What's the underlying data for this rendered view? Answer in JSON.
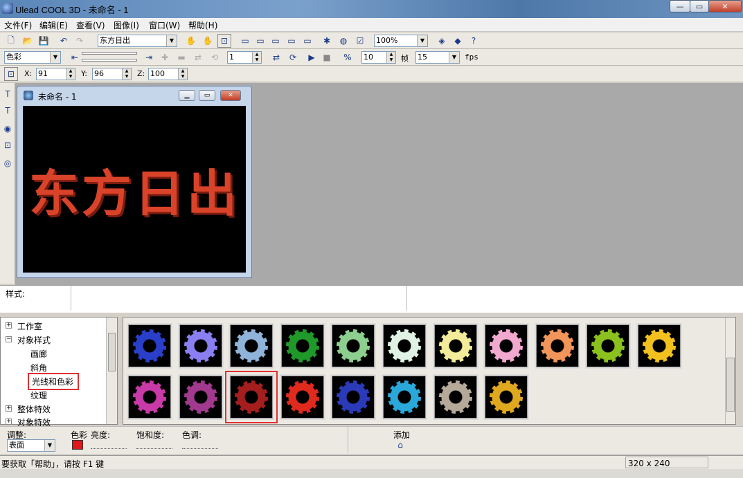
{
  "window": {
    "title": "Ulead COOL 3D - 未命名 - 1"
  },
  "menu": [
    "文件(F)",
    "编辑(E)",
    "查看(V)",
    "图像(I)",
    "窗口(W)",
    "帮助(H)"
  ],
  "toolbar1": {
    "text_object": "东方日出",
    "zoom": "100%"
  },
  "toolbar2": {
    "attribute": "色彩",
    "frame_value": "1",
    "frame_count": "10",
    "frame_label": "帧",
    "fps_value": "15",
    "fps_label": "fps"
  },
  "toolbar3": {
    "x_label": "X:",
    "x_value": "91",
    "y_label": "Y:",
    "y_value": "96",
    "z_label": "Z:",
    "z_value": "100"
  },
  "doc_window": {
    "title": "未命名 - 1",
    "canvas_text": "东方日出"
  },
  "style_panel": {
    "label": "样式:"
  },
  "tree": {
    "items": [
      "工作室",
      "对象样式",
      "画廊",
      "斜角",
      "光线和色彩",
      "纹理",
      "整体特效",
      "对象特效"
    ]
  },
  "thumbnails": {
    "colors": [
      "#2a3fc9",
      "#8a7ff0",
      "#8fb3d9",
      "#1f9a2a",
      "#8ccf8e",
      "#dff2e4",
      "#f2ec9a",
      "#f2a9d0",
      "#f2955a",
      "#8ac11e",
      "#f2c11e",
      "#c83aa8",
      "#a13a8e",
      "#a51e1e",
      "#e02a1e",
      "#2a3ab8",
      "#2aa8d9",
      "#b5aa9a",
      "#e0a81e"
    ],
    "selected_index": 13
  },
  "props": {
    "adjust_label": "调整:",
    "adjust_value": "表面",
    "color_label": "色彩",
    "brightness_label": "亮度:",
    "saturation_label": "饱和度:",
    "hue_label": "色调:",
    "add_label": "添加"
  },
  "status": {
    "help_text": "要获取「帮助」，请按 F1 键",
    "size": "320 x 240"
  }
}
